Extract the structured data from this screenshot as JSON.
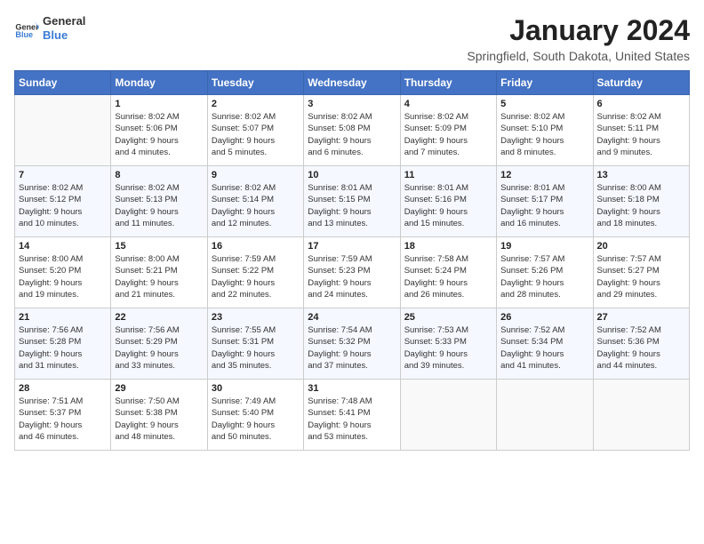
{
  "logo": {
    "line1": "General",
    "line2": "Blue"
  },
  "title": "January 2024",
  "location": "Springfield, South Dakota, United States",
  "days_header": [
    "Sunday",
    "Monday",
    "Tuesday",
    "Wednesday",
    "Thursday",
    "Friday",
    "Saturday"
  ],
  "weeks": [
    [
      {
        "num": "",
        "info": ""
      },
      {
        "num": "1",
        "info": "Sunrise: 8:02 AM\nSunset: 5:06 PM\nDaylight: 9 hours\nand 4 minutes."
      },
      {
        "num": "2",
        "info": "Sunrise: 8:02 AM\nSunset: 5:07 PM\nDaylight: 9 hours\nand 5 minutes."
      },
      {
        "num": "3",
        "info": "Sunrise: 8:02 AM\nSunset: 5:08 PM\nDaylight: 9 hours\nand 6 minutes."
      },
      {
        "num": "4",
        "info": "Sunrise: 8:02 AM\nSunset: 5:09 PM\nDaylight: 9 hours\nand 7 minutes."
      },
      {
        "num": "5",
        "info": "Sunrise: 8:02 AM\nSunset: 5:10 PM\nDaylight: 9 hours\nand 8 minutes."
      },
      {
        "num": "6",
        "info": "Sunrise: 8:02 AM\nSunset: 5:11 PM\nDaylight: 9 hours\nand 9 minutes."
      }
    ],
    [
      {
        "num": "7",
        "info": "Sunrise: 8:02 AM\nSunset: 5:12 PM\nDaylight: 9 hours\nand 10 minutes."
      },
      {
        "num": "8",
        "info": "Sunrise: 8:02 AM\nSunset: 5:13 PM\nDaylight: 9 hours\nand 11 minutes."
      },
      {
        "num": "9",
        "info": "Sunrise: 8:02 AM\nSunset: 5:14 PM\nDaylight: 9 hours\nand 12 minutes."
      },
      {
        "num": "10",
        "info": "Sunrise: 8:01 AM\nSunset: 5:15 PM\nDaylight: 9 hours\nand 13 minutes."
      },
      {
        "num": "11",
        "info": "Sunrise: 8:01 AM\nSunset: 5:16 PM\nDaylight: 9 hours\nand 15 minutes."
      },
      {
        "num": "12",
        "info": "Sunrise: 8:01 AM\nSunset: 5:17 PM\nDaylight: 9 hours\nand 16 minutes."
      },
      {
        "num": "13",
        "info": "Sunrise: 8:00 AM\nSunset: 5:18 PM\nDaylight: 9 hours\nand 18 minutes."
      }
    ],
    [
      {
        "num": "14",
        "info": "Sunrise: 8:00 AM\nSunset: 5:20 PM\nDaylight: 9 hours\nand 19 minutes."
      },
      {
        "num": "15",
        "info": "Sunrise: 8:00 AM\nSunset: 5:21 PM\nDaylight: 9 hours\nand 21 minutes."
      },
      {
        "num": "16",
        "info": "Sunrise: 7:59 AM\nSunset: 5:22 PM\nDaylight: 9 hours\nand 22 minutes."
      },
      {
        "num": "17",
        "info": "Sunrise: 7:59 AM\nSunset: 5:23 PM\nDaylight: 9 hours\nand 24 minutes."
      },
      {
        "num": "18",
        "info": "Sunrise: 7:58 AM\nSunset: 5:24 PM\nDaylight: 9 hours\nand 26 minutes."
      },
      {
        "num": "19",
        "info": "Sunrise: 7:57 AM\nSunset: 5:26 PM\nDaylight: 9 hours\nand 28 minutes."
      },
      {
        "num": "20",
        "info": "Sunrise: 7:57 AM\nSunset: 5:27 PM\nDaylight: 9 hours\nand 29 minutes."
      }
    ],
    [
      {
        "num": "21",
        "info": "Sunrise: 7:56 AM\nSunset: 5:28 PM\nDaylight: 9 hours\nand 31 minutes."
      },
      {
        "num": "22",
        "info": "Sunrise: 7:56 AM\nSunset: 5:29 PM\nDaylight: 9 hours\nand 33 minutes."
      },
      {
        "num": "23",
        "info": "Sunrise: 7:55 AM\nSunset: 5:31 PM\nDaylight: 9 hours\nand 35 minutes."
      },
      {
        "num": "24",
        "info": "Sunrise: 7:54 AM\nSunset: 5:32 PM\nDaylight: 9 hours\nand 37 minutes."
      },
      {
        "num": "25",
        "info": "Sunrise: 7:53 AM\nSunset: 5:33 PM\nDaylight: 9 hours\nand 39 minutes."
      },
      {
        "num": "26",
        "info": "Sunrise: 7:52 AM\nSunset: 5:34 PM\nDaylight: 9 hours\nand 41 minutes."
      },
      {
        "num": "27",
        "info": "Sunrise: 7:52 AM\nSunset: 5:36 PM\nDaylight: 9 hours\nand 44 minutes."
      }
    ],
    [
      {
        "num": "28",
        "info": "Sunrise: 7:51 AM\nSunset: 5:37 PM\nDaylight: 9 hours\nand 46 minutes."
      },
      {
        "num": "29",
        "info": "Sunrise: 7:50 AM\nSunset: 5:38 PM\nDaylight: 9 hours\nand 48 minutes."
      },
      {
        "num": "30",
        "info": "Sunrise: 7:49 AM\nSunset: 5:40 PM\nDaylight: 9 hours\nand 50 minutes."
      },
      {
        "num": "31",
        "info": "Sunrise: 7:48 AM\nSunset: 5:41 PM\nDaylight: 9 hours\nand 53 minutes."
      },
      {
        "num": "",
        "info": ""
      },
      {
        "num": "",
        "info": ""
      },
      {
        "num": "",
        "info": ""
      }
    ]
  ]
}
